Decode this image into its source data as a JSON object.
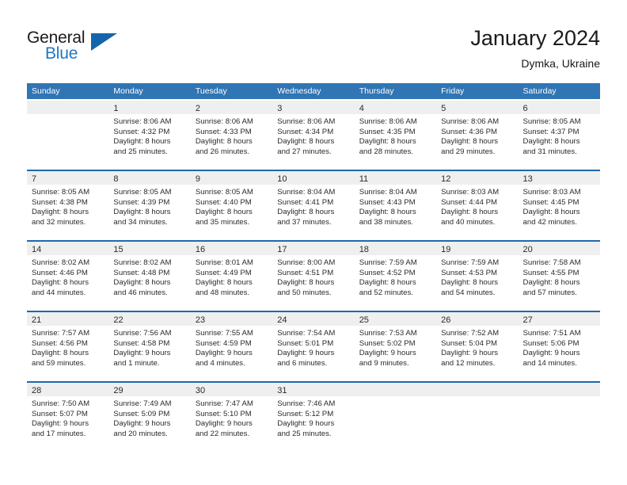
{
  "brand": {
    "name_part1": "General",
    "name_part2": "Blue",
    "icon": "triangle-logo",
    "accent_color": "#1f77c4"
  },
  "header": {
    "title": "January 2024",
    "subtitle": "Dymka, Ukraine"
  },
  "colors": {
    "header_blue": "#3075b4",
    "separator_blue": "#1f69ad",
    "day_band_gray": "#efefef",
    "text": "#2b2b2b"
  },
  "weekdays": [
    "Sunday",
    "Monday",
    "Tuesday",
    "Wednesday",
    "Thursday",
    "Friday",
    "Saturday"
  ],
  "weeks": [
    [
      {
        "day": "",
        "sunrise": "",
        "sunset": "",
        "daylight_line1": "",
        "daylight_line2": ""
      },
      {
        "day": "1",
        "sunrise": "Sunrise: 8:06 AM",
        "sunset": "Sunset: 4:32 PM",
        "daylight_line1": "Daylight: 8 hours",
        "daylight_line2": "and 25 minutes."
      },
      {
        "day": "2",
        "sunrise": "Sunrise: 8:06 AM",
        "sunset": "Sunset: 4:33 PM",
        "daylight_line1": "Daylight: 8 hours",
        "daylight_line2": "and 26 minutes."
      },
      {
        "day": "3",
        "sunrise": "Sunrise: 8:06 AM",
        "sunset": "Sunset: 4:34 PM",
        "daylight_line1": "Daylight: 8 hours",
        "daylight_line2": "and 27 minutes."
      },
      {
        "day": "4",
        "sunrise": "Sunrise: 8:06 AM",
        "sunset": "Sunset: 4:35 PM",
        "daylight_line1": "Daylight: 8 hours",
        "daylight_line2": "and 28 minutes."
      },
      {
        "day": "5",
        "sunrise": "Sunrise: 8:06 AM",
        "sunset": "Sunset: 4:36 PM",
        "daylight_line1": "Daylight: 8 hours",
        "daylight_line2": "and 29 minutes."
      },
      {
        "day": "6",
        "sunrise": "Sunrise: 8:05 AM",
        "sunset": "Sunset: 4:37 PM",
        "daylight_line1": "Daylight: 8 hours",
        "daylight_line2": "and 31 minutes."
      }
    ],
    [
      {
        "day": "7",
        "sunrise": "Sunrise: 8:05 AM",
        "sunset": "Sunset: 4:38 PM",
        "daylight_line1": "Daylight: 8 hours",
        "daylight_line2": "and 32 minutes."
      },
      {
        "day": "8",
        "sunrise": "Sunrise: 8:05 AM",
        "sunset": "Sunset: 4:39 PM",
        "daylight_line1": "Daylight: 8 hours",
        "daylight_line2": "and 34 minutes."
      },
      {
        "day": "9",
        "sunrise": "Sunrise: 8:05 AM",
        "sunset": "Sunset: 4:40 PM",
        "daylight_line1": "Daylight: 8 hours",
        "daylight_line2": "and 35 minutes."
      },
      {
        "day": "10",
        "sunrise": "Sunrise: 8:04 AM",
        "sunset": "Sunset: 4:41 PM",
        "daylight_line1": "Daylight: 8 hours",
        "daylight_line2": "and 37 minutes."
      },
      {
        "day": "11",
        "sunrise": "Sunrise: 8:04 AM",
        "sunset": "Sunset: 4:43 PM",
        "daylight_line1": "Daylight: 8 hours",
        "daylight_line2": "and 38 minutes."
      },
      {
        "day": "12",
        "sunrise": "Sunrise: 8:03 AM",
        "sunset": "Sunset: 4:44 PM",
        "daylight_line1": "Daylight: 8 hours",
        "daylight_line2": "and 40 minutes."
      },
      {
        "day": "13",
        "sunrise": "Sunrise: 8:03 AM",
        "sunset": "Sunset: 4:45 PM",
        "daylight_line1": "Daylight: 8 hours",
        "daylight_line2": "and 42 minutes."
      }
    ],
    [
      {
        "day": "14",
        "sunrise": "Sunrise: 8:02 AM",
        "sunset": "Sunset: 4:46 PM",
        "daylight_line1": "Daylight: 8 hours",
        "daylight_line2": "and 44 minutes."
      },
      {
        "day": "15",
        "sunrise": "Sunrise: 8:02 AM",
        "sunset": "Sunset: 4:48 PM",
        "daylight_line1": "Daylight: 8 hours",
        "daylight_line2": "and 46 minutes."
      },
      {
        "day": "16",
        "sunrise": "Sunrise: 8:01 AM",
        "sunset": "Sunset: 4:49 PM",
        "daylight_line1": "Daylight: 8 hours",
        "daylight_line2": "and 48 minutes."
      },
      {
        "day": "17",
        "sunrise": "Sunrise: 8:00 AM",
        "sunset": "Sunset: 4:51 PM",
        "daylight_line1": "Daylight: 8 hours",
        "daylight_line2": "and 50 minutes."
      },
      {
        "day": "18",
        "sunrise": "Sunrise: 7:59 AM",
        "sunset": "Sunset: 4:52 PM",
        "daylight_line1": "Daylight: 8 hours",
        "daylight_line2": "and 52 minutes."
      },
      {
        "day": "19",
        "sunrise": "Sunrise: 7:59 AM",
        "sunset": "Sunset: 4:53 PM",
        "daylight_line1": "Daylight: 8 hours",
        "daylight_line2": "and 54 minutes."
      },
      {
        "day": "20",
        "sunrise": "Sunrise: 7:58 AM",
        "sunset": "Sunset: 4:55 PM",
        "daylight_line1": "Daylight: 8 hours",
        "daylight_line2": "and 57 minutes."
      }
    ],
    [
      {
        "day": "21",
        "sunrise": "Sunrise: 7:57 AM",
        "sunset": "Sunset: 4:56 PM",
        "daylight_line1": "Daylight: 8 hours",
        "daylight_line2": "and 59 minutes."
      },
      {
        "day": "22",
        "sunrise": "Sunrise: 7:56 AM",
        "sunset": "Sunset: 4:58 PM",
        "daylight_line1": "Daylight: 9 hours",
        "daylight_line2": "and 1 minute."
      },
      {
        "day": "23",
        "sunrise": "Sunrise: 7:55 AM",
        "sunset": "Sunset: 4:59 PM",
        "daylight_line1": "Daylight: 9 hours",
        "daylight_line2": "and 4 minutes."
      },
      {
        "day": "24",
        "sunrise": "Sunrise: 7:54 AM",
        "sunset": "Sunset: 5:01 PM",
        "daylight_line1": "Daylight: 9 hours",
        "daylight_line2": "and 6 minutes."
      },
      {
        "day": "25",
        "sunrise": "Sunrise: 7:53 AM",
        "sunset": "Sunset: 5:02 PM",
        "daylight_line1": "Daylight: 9 hours",
        "daylight_line2": "and 9 minutes."
      },
      {
        "day": "26",
        "sunrise": "Sunrise: 7:52 AM",
        "sunset": "Sunset: 5:04 PM",
        "daylight_line1": "Daylight: 9 hours",
        "daylight_line2": "and 12 minutes."
      },
      {
        "day": "27",
        "sunrise": "Sunrise: 7:51 AM",
        "sunset": "Sunset: 5:06 PM",
        "daylight_line1": "Daylight: 9 hours",
        "daylight_line2": "and 14 minutes."
      }
    ],
    [
      {
        "day": "28",
        "sunrise": "Sunrise: 7:50 AM",
        "sunset": "Sunset: 5:07 PM",
        "daylight_line1": "Daylight: 9 hours",
        "daylight_line2": "and 17 minutes."
      },
      {
        "day": "29",
        "sunrise": "Sunrise: 7:49 AM",
        "sunset": "Sunset: 5:09 PM",
        "daylight_line1": "Daylight: 9 hours",
        "daylight_line2": "and 20 minutes."
      },
      {
        "day": "30",
        "sunrise": "Sunrise: 7:47 AM",
        "sunset": "Sunset: 5:10 PM",
        "daylight_line1": "Daylight: 9 hours",
        "daylight_line2": "and 22 minutes."
      },
      {
        "day": "31",
        "sunrise": "Sunrise: 7:46 AM",
        "sunset": "Sunset: 5:12 PM",
        "daylight_line1": "Daylight: 9 hours",
        "daylight_line2": "and 25 minutes."
      },
      {
        "day": "",
        "sunrise": "",
        "sunset": "",
        "daylight_line1": "",
        "daylight_line2": ""
      },
      {
        "day": "",
        "sunrise": "",
        "sunset": "",
        "daylight_line1": "",
        "daylight_line2": ""
      },
      {
        "day": "",
        "sunrise": "",
        "sunset": "",
        "daylight_line1": "",
        "daylight_line2": ""
      }
    ]
  ]
}
